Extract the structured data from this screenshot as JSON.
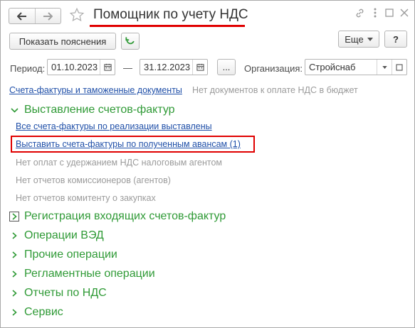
{
  "header": {
    "title": "Помощник по учету НДС",
    "back_icon": "arrow-left-icon",
    "forward_icon": "arrow-right-icon",
    "favorite_icon": "star-outline-icon",
    "link_icon": "link-icon",
    "menu_icon": "kebab-icon",
    "maximize_icon": "maximize-icon",
    "close_icon": "close-icon"
  },
  "toolbar": {
    "explain_label": "Показать пояснения",
    "refresh_icon": "refresh-icon",
    "more_label": "Еще",
    "help_label": "?"
  },
  "filters": {
    "period_label": "Период:",
    "date_from": "01.10.2023",
    "dash": "—",
    "date_to": "31.12.2023",
    "ellipsis_label": "...",
    "org_label": "Организация:",
    "org_value": "Стройснаб"
  },
  "links": {
    "invoices_customs": "Счета-фактуры и таможенные документы",
    "no_docs_budget": "Нет документов к оплате НДС в бюджет"
  },
  "sections": {
    "issuing": {
      "title": "Выставление счетов-фактур",
      "items": {
        "all_issued": "Все счета-фактуры по реализации выставлены",
        "issue_advances": "Выставить счета-фактуры по полученным авансам (1)",
        "no_tax_agent": "Нет оплат с удержанием НДС налоговым агентом",
        "no_commission_agents": "Нет отчетов комиссионеров (агентов)",
        "no_principal_reports": "Нет отчетов комитенту о закупках"
      }
    },
    "collapsed": [
      "Регистрация входящих счетов-фактур",
      "Операции ВЭД",
      "Прочие операции",
      "Регламентные операции",
      "Отчеты по НДС",
      "Сервис"
    ]
  },
  "colors": {
    "accent_green": "#2f9a36",
    "link_blue": "#1f4fa8",
    "highlight_red": "#e00000"
  }
}
